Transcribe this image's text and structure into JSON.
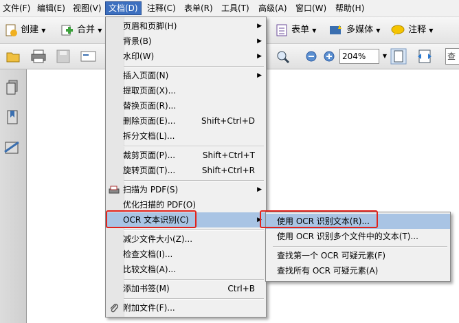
{
  "menubar": {
    "items": [
      {
        "label": "文件(F)"
      },
      {
        "label": "编辑(E)"
      },
      {
        "label": "视图(V)"
      },
      {
        "label": "文档(D)"
      },
      {
        "label": "注释(C)"
      },
      {
        "label": "表单(R)"
      },
      {
        "label": "工具(T)"
      },
      {
        "label": "高级(A)"
      },
      {
        "label": "窗口(W)"
      },
      {
        "label": "帮助(H)"
      }
    ]
  },
  "toolbar1": {
    "create": "创建",
    "combine": "合并",
    "forms": "表单",
    "multimedia": "多媒体",
    "comment": "注释"
  },
  "toolbar2": {
    "zoom_value": "204%",
    "search_placeholder": "查"
  },
  "document_menu": {
    "items": [
      {
        "label": "页眉和页脚(H)",
        "shortcut": "",
        "submenu": true
      },
      {
        "label": "背景(B)",
        "shortcut": "",
        "submenu": true
      },
      {
        "label": "水印(W)",
        "shortcut": "",
        "submenu": true
      },
      {
        "label": "插入页面(N)",
        "shortcut": "",
        "submenu": true
      },
      {
        "label": "提取页面(X)...",
        "shortcut": ""
      },
      {
        "label": "替换页面(R)...",
        "shortcut": ""
      },
      {
        "label": "删除页面(E)...",
        "shortcut": "Shift+Ctrl+D"
      },
      {
        "label": "拆分文档(L)...",
        "shortcut": ""
      },
      {
        "label": "裁剪页面(P)...",
        "shortcut": "Shift+Ctrl+T"
      },
      {
        "label": "旋转页面(T)...",
        "shortcut": "Shift+Ctrl+R"
      },
      {
        "label": "扫描为 PDF(S)",
        "shortcut": "",
        "submenu": true
      },
      {
        "label": "优化扫描的 PDF(O)",
        "shortcut": ""
      },
      {
        "label": "OCR 文本识别(C)",
        "shortcut": "",
        "submenu": true
      },
      {
        "label": "减少文件大小(Z)...",
        "shortcut": ""
      },
      {
        "label": "检查文档(I)...",
        "shortcut": ""
      },
      {
        "label": "比较文档(A)...",
        "shortcut": ""
      },
      {
        "label": "添加书签(M)",
        "shortcut": "Ctrl+B"
      },
      {
        "label": "附加文件(F)...",
        "shortcut": ""
      }
    ]
  },
  "ocr_submenu": {
    "items": [
      {
        "label": "使用 OCR 识别文本(R)..."
      },
      {
        "label": "使用 OCR 识别多个文件中的文本(T)..."
      },
      {
        "label": "查找第一个 OCR 可疑元素(F)"
      },
      {
        "label": "查找所有 OCR 可疑元素(A)"
      }
    ]
  },
  "colors": {
    "active_menu": "#3c6fbf",
    "highlight": "#a9c4e4",
    "annotation_red": "#e0231c"
  }
}
